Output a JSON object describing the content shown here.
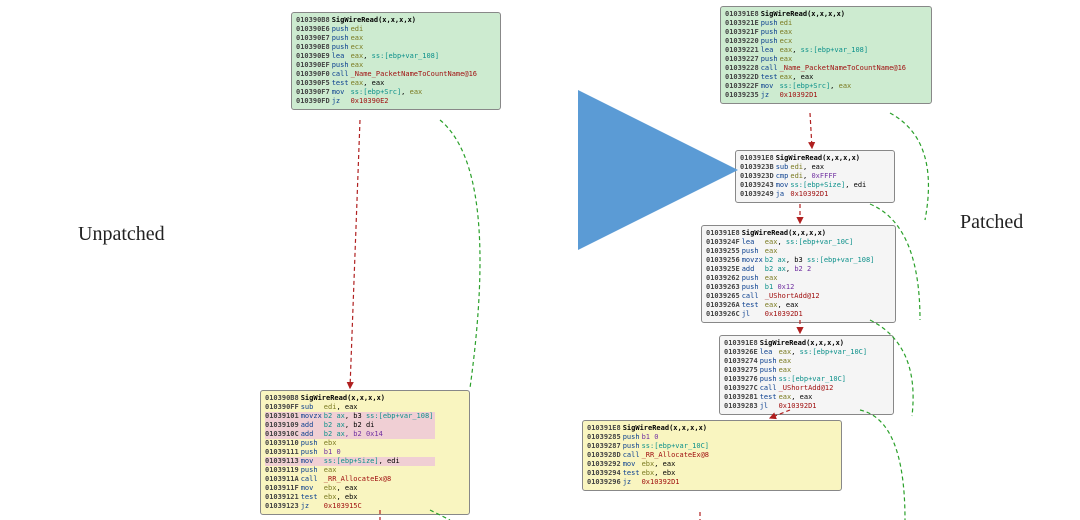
{
  "labels": {
    "left": "Unpatched",
    "right": "Patched"
  },
  "style": {
    "red_arrow": "#b02020",
    "green_arrow": "#2aa02a",
    "blue_arrow": "#5b9bd5"
  },
  "left": {
    "block1": {
      "title_addr": "010390B8",
      "title": "SigWireRead(x,x,x,x)",
      "rows": [
        {
          "addr": "010390E6",
          "mnem": "push",
          "ops": [
            {
              "t": "edi",
              "c": "o-olive"
            }
          ]
        },
        {
          "addr": "010390E7",
          "mnem": "push",
          "ops": [
            {
              "t": "eax",
              "c": "o-olive"
            }
          ]
        },
        {
          "addr": "010390E8",
          "mnem": "push",
          "ops": [
            {
              "t": "ecx",
              "c": "o-olive"
            }
          ]
        },
        {
          "addr": "010390E9",
          "mnem": "lea",
          "ops": [
            {
              "t": "eax",
              "c": "o-olive"
            },
            {
              "t": ", ",
              "c": "o-blk"
            },
            {
              "t": "ss:",
              "c": "o-teal"
            },
            {
              "t": "[ebp+var_108]",
              "c": "o-teal"
            }
          ]
        },
        {
          "addr": "010390EF",
          "mnem": "push",
          "ops": [
            {
              "t": "eax",
              "c": "o-olive"
            }
          ]
        },
        {
          "addr": "010390F0",
          "mnem": "call",
          "ops": [
            {
              "t": "_Name_PacketNameToCountName@16",
              "c": "o-red"
            }
          ]
        },
        {
          "addr": "010390F5",
          "mnem": "test",
          "ops": [
            {
              "t": "eax",
              "c": "o-olive"
            },
            {
              "t": ", eax",
              "c": "o-blk"
            }
          ]
        },
        {
          "addr": "010390F7",
          "mnem": "mov",
          "ops": [
            {
              "t": "ss:",
              "c": "o-teal"
            },
            {
              "t": "[ebp+Src]",
              "c": "o-teal"
            },
            {
              "t": ", ",
              "c": "o-blk"
            },
            {
              "t": "eax",
              "c": "o-olive"
            }
          ]
        },
        {
          "addr": "010390FD",
          "mnem": "jz",
          "ops": [
            {
              "t": "0x10390E2",
              "c": "o-red"
            }
          ]
        }
      ]
    },
    "block2": {
      "title_addr": "010390B8",
      "title": "SigWireRead(x,x,x,x)",
      "rows": [
        {
          "addr": "010390FF",
          "mnem": "sub",
          "ops": [
            {
              "t": "edi",
              "c": "o-olive"
            },
            {
              "t": ", eax",
              "c": "o-blk"
            }
          ]
        },
        {
          "addr": "01039101",
          "mnem": "movzx",
          "ops": [
            {
              "t": "b2 ax",
              "c": "o-teal"
            },
            {
              "t": ", b3 ",
              "c": "o-blk"
            },
            {
              "t": "ss:",
              "c": "o-teal"
            },
            {
              "t": "[ebp+var_108]",
              "c": "o-teal"
            }
          ],
          "hl": true
        },
        {
          "addr": "01039109",
          "mnem": "add",
          "ops": [
            {
              "t": "b2 ax",
              "c": "o-teal"
            },
            {
              "t": ", b2 di",
              "c": "o-blk"
            }
          ],
          "hl": true
        },
        {
          "addr": "0103910C",
          "mnem": "add",
          "ops": [
            {
              "t": "b2 ax",
              "c": "o-teal"
            },
            {
              "t": ", b2 0x14",
              "c": "o-pur"
            }
          ],
          "hl": true
        },
        {
          "addr": "01039110",
          "mnem": "push",
          "ops": [
            {
              "t": "ebx",
              "c": "o-olive"
            }
          ]
        },
        {
          "addr": "01039111",
          "mnem": "push",
          "ops": [
            {
              "t": "b1 0",
              "c": "o-pur"
            }
          ]
        },
        {
          "addr": "01039113",
          "mnem": "mov",
          "ops": [
            {
              "t": "ss:",
              "c": "o-teal"
            },
            {
              "t": "[ebp+Size]",
              "c": "o-teal"
            },
            {
              "t": ", edi",
              "c": "o-blk"
            }
          ],
          "hl": true
        },
        {
          "addr": "01039119",
          "mnem": "push",
          "ops": [
            {
              "t": "eax",
              "c": "o-olive"
            }
          ]
        },
        {
          "addr": "0103911A",
          "mnem": "call",
          "ops": [
            {
              "t": "_RR_AllocateEx@8",
              "c": "o-red"
            }
          ]
        },
        {
          "addr": "0103911F",
          "mnem": "mov",
          "ops": [
            {
              "t": "ebx",
              "c": "o-olive"
            },
            {
              "t": ", eax",
              "c": "o-blk"
            }
          ]
        },
        {
          "addr": "01039121",
          "mnem": "test",
          "ops": [
            {
              "t": "ebx",
              "c": "o-olive"
            },
            {
              "t": ", ebx",
              "c": "o-blk"
            }
          ]
        },
        {
          "addr": "01039123",
          "mnem": "jz",
          "ops": [
            {
              "t": "0x103915C",
              "c": "o-red"
            }
          ]
        }
      ]
    }
  },
  "right": {
    "block1": {
      "title_addr": "010391E8",
      "title": "SigWireRead(x,x,x,x)",
      "rows": [
        {
          "addr": "0103921E",
          "mnem": "push",
          "ops": [
            {
              "t": "edi",
              "c": "o-olive"
            }
          ]
        },
        {
          "addr": "0103921F",
          "mnem": "push",
          "ops": [
            {
              "t": "eax",
              "c": "o-olive"
            }
          ]
        },
        {
          "addr": "01039220",
          "mnem": "push",
          "ops": [
            {
              "t": "ecx",
              "c": "o-olive"
            }
          ]
        },
        {
          "addr": "01039221",
          "mnem": "lea",
          "ops": [
            {
              "t": "eax",
              "c": "o-olive"
            },
            {
              "t": ", ",
              "c": "o-blk"
            },
            {
              "t": "ss:",
              "c": "o-teal"
            },
            {
              "t": "[ebp+var_108]",
              "c": "o-teal"
            }
          ]
        },
        {
          "addr": "01039227",
          "mnem": "push",
          "ops": [
            {
              "t": "eax",
              "c": "o-olive"
            }
          ]
        },
        {
          "addr": "01039228",
          "mnem": "call",
          "ops": [
            {
              "t": "_Name_PacketNameToCountName@16",
              "c": "o-red"
            }
          ]
        },
        {
          "addr": "0103922D",
          "mnem": "test",
          "ops": [
            {
              "t": "eax",
              "c": "o-olive"
            },
            {
              "t": ", eax",
              "c": "o-blk"
            }
          ]
        },
        {
          "addr": "0103922F",
          "mnem": "mov",
          "ops": [
            {
              "t": "ss:",
              "c": "o-teal"
            },
            {
              "t": "[ebp+Src]",
              "c": "o-teal"
            },
            {
              "t": ", ",
              "c": "o-blk"
            },
            {
              "t": "eax",
              "c": "o-olive"
            }
          ]
        },
        {
          "addr": "01039235",
          "mnem": "jz",
          "ops": [
            {
              "t": "0x10392D1",
              "c": "o-red"
            }
          ]
        }
      ]
    },
    "block2": {
      "title_addr": "010391E8",
      "title": "SigWireRead(x,x,x,x)",
      "rows": [
        {
          "addr": "0103923B",
          "mnem": "sub",
          "ops": [
            {
              "t": "edi",
              "c": "o-olive"
            },
            {
              "t": ", eax",
              "c": "o-blk"
            }
          ]
        },
        {
          "addr": "0103923D",
          "mnem": "cmp",
          "ops": [
            {
              "t": "edi",
              "c": "o-olive"
            },
            {
              "t": ", ",
              "c": "o-blk"
            },
            {
              "t": "0xFFFF",
              "c": "o-pur"
            }
          ]
        },
        {
          "addr": "01039243",
          "mnem": "mov",
          "ops": [
            {
              "t": "ss:",
              "c": "o-teal"
            },
            {
              "t": "[ebp+Size]",
              "c": "o-teal"
            },
            {
              "t": ", edi",
              "c": "o-blk"
            }
          ]
        },
        {
          "addr": "01039249",
          "mnem": "ja",
          "ops": [
            {
              "t": "0x10392D1",
              "c": "o-red"
            }
          ]
        }
      ]
    },
    "block3": {
      "title_addr": "010391E8",
      "title": "SigWireRead(x,x,x,x)",
      "rows": [
        {
          "addr": "0103924F",
          "mnem": "lea",
          "ops": [
            {
              "t": "eax",
              "c": "o-olive"
            },
            {
              "t": ", ",
              "c": "o-blk"
            },
            {
              "t": "ss:",
              "c": "o-teal"
            },
            {
              "t": "[ebp+var_10C]",
              "c": "o-teal"
            }
          ]
        },
        {
          "addr": "01039255",
          "mnem": "push",
          "ops": [
            {
              "t": "eax",
              "c": "o-olive"
            }
          ]
        },
        {
          "addr": "01039256",
          "mnem": "movzx",
          "ops": [
            {
              "t": "b2 ax",
              "c": "o-teal"
            },
            {
              "t": ", b3 ",
              "c": "o-blk"
            },
            {
              "t": "ss:",
              "c": "o-teal"
            },
            {
              "t": "[ebp+var_108]",
              "c": "o-teal"
            }
          ]
        },
        {
          "addr": "0103925E",
          "mnem": "add",
          "ops": [
            {
              "t": "b2 ax",
              "c": "o-teal"
            },
            {
              "t": ", ",
              "c": "o-blk"
            },
            {
              "t": "b2 2",
              "c": "o-pur"
            }
          ]
        },
        {
          "addr": "01039262",
          "mnem": "push",
          "ops": [
            {
              "t": "eax",
              "c": "o-olive"
            }
          ]
        },
        {
          "addr": "01039263",
          "mnem": "push",
          "ops": [
            {
              "t": "b1",
              "c": "o-teal"
            },
            {
              "t": " 0x12",
              "c": "o-pur"
            }
          ]
        },
        {
          "addr": "01039265",
          "mnem": "call",
          "ops": [
            {
              "t": "_UShortAdd@12",
              "c": "o-red"
            }
          ]
        },
        {
          "addr": "0103926A",
          "mnem": "test",
          "ops": [
            {
              "t": "eax",
              "c": "o-olive"
            },
            {
              "t": ", eax",
              "c": "o-blk"
            }
          ]
        },
        {
          "addr": "0103926C",
          "mnem": "jl",
          "ops": [
            {
              "t": "0x10392D1",
              "c": "o-red"
            }
          ]
        }
      ]
    },
    "block4": {
      "title_addr": "010391E8",
      "title": "SigWireRead(x,x,x,x)",
      "rows": [
        {
          "addr": "0103926E",
          "mnem": "lea",
          "ops": [
            {
              "t": "eax",
              "c": "o-olive"
            },
            {
              "t": ", ",
              "c": "o-blk"
            },
            {
              "t": "ss:",
              "c": "o-teal"
            },
            {
              "t": "[ebp+var_10C]",
              "c": "o-teal"
            }
          ]
        },
        {
          "addr": "01039274",
          "mnem": "push",
          "ops": [
            {
              "t": "eax",
              "c": "o-olive"
            }
          ]
        },
        {
          "addr": "01039275",
          "mnem": "push",
          "ops": [
            {
              "t": "eax",
              "c": "o-olive"
            }
          ]
        },
        {
          "addr": "01039276",
          "mnem": "push",
          "ops": [
            {
              "t": "ss:",
              "c": "o-teal"
            },
            {
              "t": "[ebp+var_10C]",
              "c": "o-teal"
            }
          ]
        },
        {
          "addr": "0103927C",
          "mnem": "call",
          "ops": [
            {
              "t": "_UShortAdd@12",
              "c": "o-red"
            }
          ]
        },
        {
          "addr": "01039281",
          "mnem": "test",
          "ops": [
            {
              "t": "eax",
              "c": "o-olive"
            },
            {
              "t": ", eax",
              "c": "o-blk"
            }
          ]
        },
        {
          "addr": "01039283",
          "mnem": "jl",
          "ops": [
            {
              "t": "0x10392D1",
              "c": "o-red"
            }
          ]
        }
      ]
    },
    "block5": {
      "title_addr": "010391E8",
      "title": "SigWireRead(x,x,x,x)",
      "rows": [
        {
          "addr": "",
          "mnem": "",
          "ops": []
        },
        {
          "addr": "01039285",
          "mnem": "push",
          "ops": [
            {
              "t": "b1 0",
              "c": "o-pur"
            }
          ]
        },
        {
          "addr": "",
          "mnem": "",
          "ops": []
        },
        {
          "addr": "01039287",
          "mnem": "push",
          "ops": [
            {
              "t": "ss:",
              "c": "o-teal"
            },
            {
              "t": "[ebp+var_10C]",
              "c": "o-teal"
            }
          ]
        },
        {
          "addr": "0103928D",
          "mnem": "call",
          "ops": [
            {
              "t": "_RR_AllocateEx@8",
              "c": "o-red"
            }
          ]
        },
        {
          "addr": "01039292",
          "mnem": "mov",
          "ops": [
            {
              "t": "ebx",
              "c": "o-olive"
            },
            {
              "t": ", eax",
              "c": "o-blk"
            }
          ]
        },
        {
          "addr": "01039294",
          "mnem": "test",
          "ops": [
            {
              "t": "ebx",
              "c": "o-olive"
            },
            {
              "t": ", ebx",
              "c": "o-blk"
            }
          ]
        },
        {
          "addr": "01039296",
          "mnem": "jz",
          "ops": [
            {
              "t": "0x10392D1",
              "c": "o-red"
            }
          ]
        }
      ]
    }
  }
}
